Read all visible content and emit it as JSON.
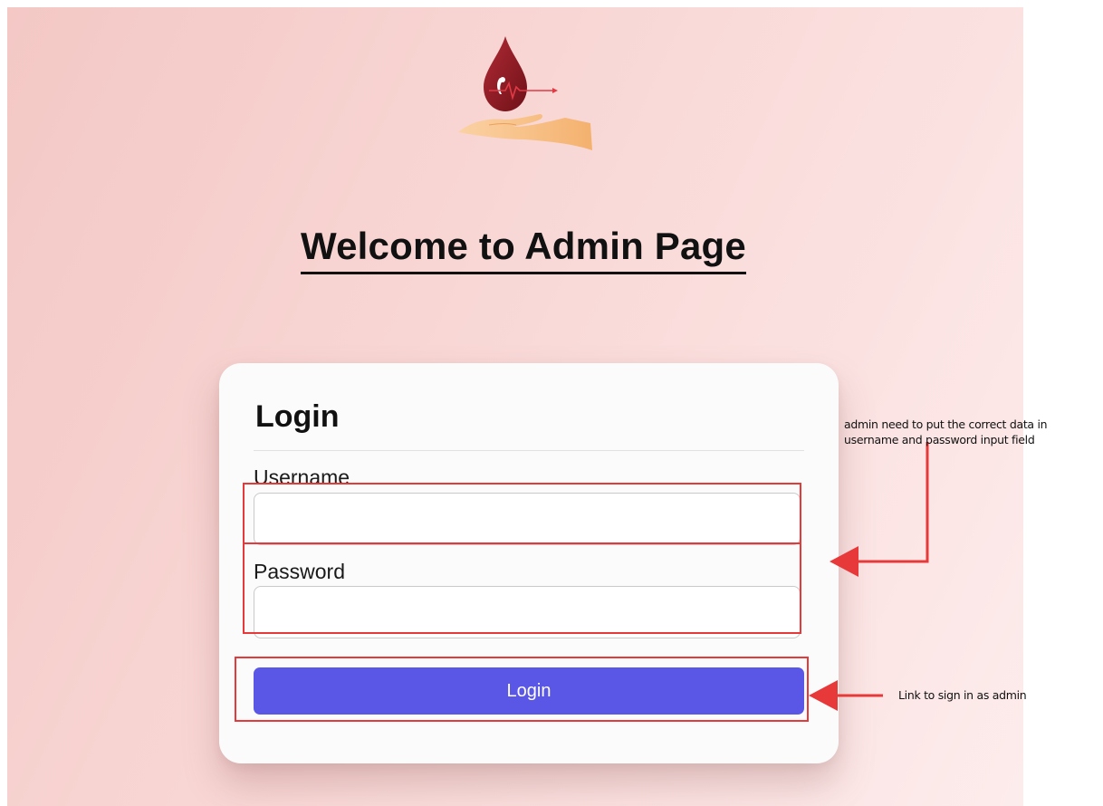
{
  "header": {
    "logo_icon": "blood-drop-hand-logo",
    "title": "Welcome to Admin Page"
  },
  "login_card": {
    "title": "Login",
    "username_label": "Username",
    "username_value": "",
    "password_label": "Password",
    "password_value": "",
    "submit_label": "Login"
  },
  "annotations": {
    "input_fields_note_line1": "admin need to put the correct data in",
    "input_fields_note_line2": "username and password input field",
    "login_button_note": "Link to sign in as admin"
  },
  "colors": {
    "background_gradient_start": "#f3c8c5",
    "background_gradient_end": "#fdecec",
    "button": "#5a57e6",
    "annotation_red": "#e8393a",
    "drop_red": "#8e1b22",
    "hand": "#f6bf86"
  }
}
